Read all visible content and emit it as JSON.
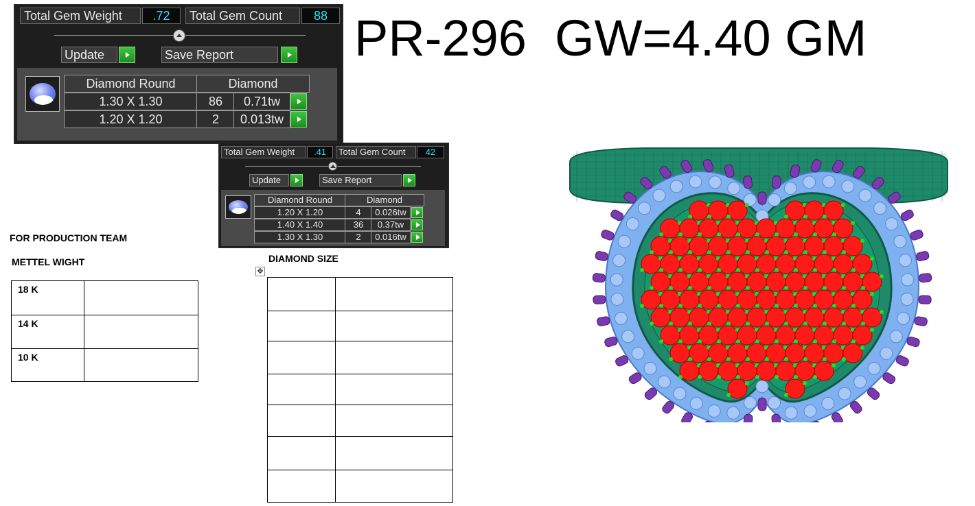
{
  "report_panel_1": {
    "total_gem_weight_label": "Total Gem Weight",
    "total_gem_weight_value": ".72",
    "total_gem_count_label": "Total Gem Count",
    "total_gem_count_value": "88",
    "update_label": "Update",
    "save_report_label": "Save Report",
    "table": {
      "headers": [
        "Diamond Round",
        "Diamond"
      ],
      "rows": [
        {
          "size": "1.30 X 1.30",
          "count": "86",
          "weight": "0.71tw"
        },
        {
          "size": "1.20 X 1.20",
          "count": "2",
          "weight": "0.013tw"
        }
      ]
    }
  },
  "report_panel_2": {
    "total_gem_weight_label": "Total Gem Weight",
    "total_gem_weight_value": ".41",
    "total_gem_count_label": "Total Gem Count",
    "total_gem_count_value": "42",
    "update_label": "Update",
    "save_report_label": "Save Report",
    "table": {
      "headers": [
        "Diamond Round",
        "Diamond"
      ],
      "rows": [
        {
          "size": "1.20 X 1.20",
          "count": "4",
          "weight": "0.026tw"
        },
        {
          "size": "1.40 X 1.40",
          "count": "36",
          "weight": "0.37tw"
        },
        {
          "size": "1.30 X 1.30",
          "count": "2",
          "weight": "0.016tw"
        }
      ]
    }
  },
  "title": "PR-296  GW=4.40 GM",
  "document": {
    "production_heading": "FOR PRODUCTION TEAM",
    "metal_weight_heading": "METTEL WIGHT",
    "metal_rows": [
      "18 K",
      "14 K",
      "10 K"
    ],
    "diamond_size_heading": "DIAMOND SIZE",
    "move_handle_icon": "move-arrows-icon"
  },
  "render": {
    "colors": {
      "band": "#1f8a6a",
      "halo": "#7fb0f0",
      "prongs": "#7a3ab0",
      "center_stones": "#ff1a1a",
      "accent_prongs": "#22dd22"
    }
  }
}
